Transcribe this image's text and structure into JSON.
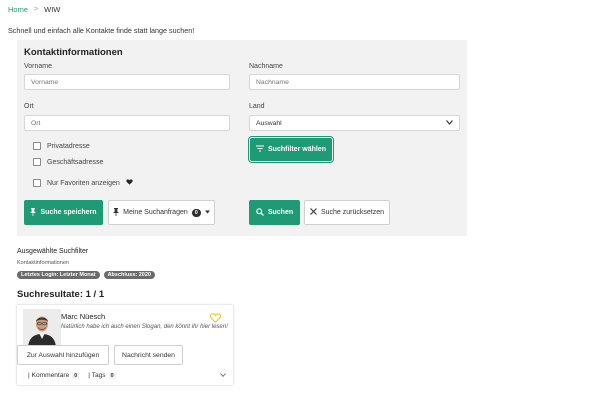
{
  "breadcrumb": {
    "home": "Home",
    "separator": ">",
    "current": "WIW"
  },
  "tagline": "Schnell und einfach alle Kontakte finde statt lange suchen!",
  "form": {
    "title": "Kontaktinformationen",
    "vorname": {
      "label": "Vorname",
      "placeholder": "Vorname"
    },
    "nachname": {
      "label": "Nachname",
      "placeholder": "Nachname"
    },
    "ort": {
      "label": "Ort",
      "placeholder": "Ort"
    },
    "land": {
      "label": "Land",
      "value": "Auswahl"
    },
    "checkboxes": {
      "privat": "Privatadresse",
      "geschaeft": "Geschäftsadresse",
      "favoriten": "Nur Favoriten anzeigen"
    },
    "filter_button": "Suchfilter wählen",
    "save_button": "Suche speichern",
    "my_searches_button": "Meine Suchanfragen",
    "my_searches_count": "0",
    "search_button": "Suchen",
    "reset_button": "Suche zurücksetzen"
  },
  "selected_filters": {
    "title": "Ausgewählte Suchfilter",
    "subtitle": "Kontaktinformationen",
    "chips": [
      "Letztes Login: Letzter Monat",
      "Abschluss: 2020"
    ]
  },
  "results": {
    "title": "Suchresultate: 1 / 1",
    "items": [
      {
        "name": "Marc Nüesch",
        "slogan": "Natürlich habe ich auch einen Slogan, den könnt ihr hier lesen!",
        "add_button": "Zur Auswahl hinzufügen",
        "message_button": "Nachricht senden",
        "comments_label": "| Kommentare",
        "comments_count": "0",
        "tags_label": "| Tags",
        "tags_count": "0"
      }
    ]
  },
  "colors": {
    "accent": "#1e9a74",
    "panel": "#f2f2f2",
    "heart_fav": "#e8c21a"
  }
}
